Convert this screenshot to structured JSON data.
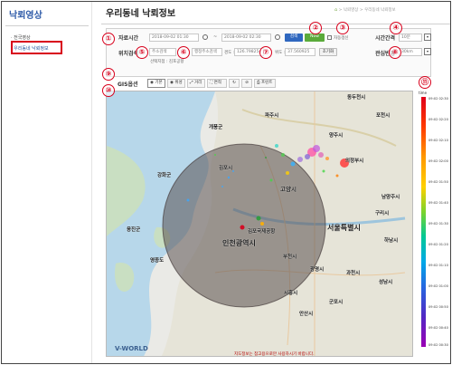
{
  "sidebar": {
    "title": "낙뢰영상",
    "items": [
      {
        "label": "· 전국영상"
      },
      {
        "label": "· 우리동네 낙뢰정보"
      }
    ]
  },
  "header": {
    "title": "우리동네 낙뢰정보",
    "breadcrumb": [
      "낙뢰영상",
      "우리동네 낙뢰정보"
    ],
    "breadcrumb_separator": ">"
  },
  "controls": {
    "time_label": "자료시간",
    "start_time": "2018-09-02 01:30",
    "time_separator": "~",
    "end_time": "2018-09-02 02:30",
    "search_button": "검색",
    "now_button": "Now",
    "auto_update_label": "자동갱신",
    "interval_label": "시간간격",
    "interval_value": "10분",
    "location_label": "위치검색",
    "address_select": "주소검색",
    "address_input": "행정주소검색",
    "lon_label": "경도 :",
    "lon_value": "126.798254",
    "lat_label": "위도 :",
    "lat_value": "37.560925",
    "reset_button": "초기화",
    "airport_note": "선택지점 : 김포공항",
    "radius_label": "관심반경",
    "radius_value": "30km"
  },
  "gis": {
    "label": "GIS옵션",
    "options": [
      "기본",
      "위성",
      "거리",
      "면적",
      "",
      "",
      "프린트"
    ]
  },
  "annotations": [
    "①",
    "②",
    "③",
    "④",
    "⑤",
    "⑥",
    "⑦",
    "⑧",
    "⑨",
    "⑩",
    "⑪"
  ],
  "map": {
    "labels": {
      "dongducheon": "동두천시",
      "pocheon": "포천시",
      "paju": "파주시",
      "yangju": "양주시",
      "gaepung": "개풍군",
      "gimpo": "김포시",
      "uijeongbu": "의정부시",
      "ganghwa": "강화군",
      "goyang": "고양시",
      "guri": "구리시",
      "namyangju": "남양주시",
      "seoul": "서울특별시",
      "hanam": "하남시",
      "incheon": "인천광역시",
      "gwacheon": "과천시",
      "seongnam": "성남시",
      "siheung": "시흥시",
      "gunpo": "군포시",
      "ansan": "안산시",
      "gwangmyeong": "광명시",
      "ongjin": "옹진군",
      "bucheon": "부천시",
      "gimpo_airport": "김포국제공항",
      "yeongjong": "영종도"
    },
    "logo": "V-WORLD",
    "notice": "지도정보는 참고용으로만 사용하시기 바랍니다."
  },
  "legend": {
    "unit": "time",
    "ticks": [
      "09:02 02:30",
      "09:02 02:20",
      "09:02 02:10",
      "09:02 02:00",
      "09:02 01:50",
      "09:02 01:40",
      "09:02 01:30",
      "09:02 01:20",
      "09:02 01:10",
      "09:02 01:00",
      "09:02 00:50",
      "09:02 00:40",
      "09:02 00:30"
    ]
  }
}
